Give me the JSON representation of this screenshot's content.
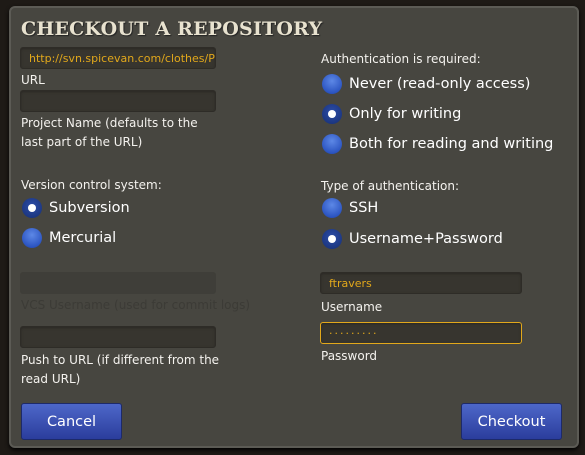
{
  "title": "CHECKOUT A REPOSITORY",
  "left": {
    "url": {
      "value": "http://svn.spicevan.com/clothes/Pr",
      "label": "URL"
    },
    "project_name": {
      "value": "",
      "label": "Project Name (defaults to the last part of the URL)"
    },
    "vcs_label": "Version control system:",
    "vcs_options": [
      {
        "label": "Subversion",
        "selected": true
      },
      {
        "label": "Mercurial",
        "selected": false
      }
    ],
    "vcs_username": {
      "value": "",
      "label": "VCS Username (used for commit logs)",
      "disabled": true
    },
    "push_url": {
      "value": "",
      "label": "Push to URL (if different from the read URL)"
    }
  },
  "right": {
    "auth_label": "Authentication is required:",
    "auth_options": [
      {
        "label": "Never (read-only access)",
        "selected": false
      },
      {
        "label": "Only for writing",
        "selected": true
      },
      {
        "label": "Both for reading and writing",
        "selected": false
      }
    ],
    "type_label": "Type of authentication:",
    "type_options": [
      {
        "label": "SSH",
        "selected": false
      },
      {
        "label": "Username+Password",
        "selected": true
      }
    ],
    "username": {
      "value": "ftravers",
      "label": "Username"
    },
    "password": {
      "value": "·········",
      "label": "Password"
    }
  },
  "buttons": {
    "cancel": "Cancel",
    "checkout": "Checkout"
  }
}
